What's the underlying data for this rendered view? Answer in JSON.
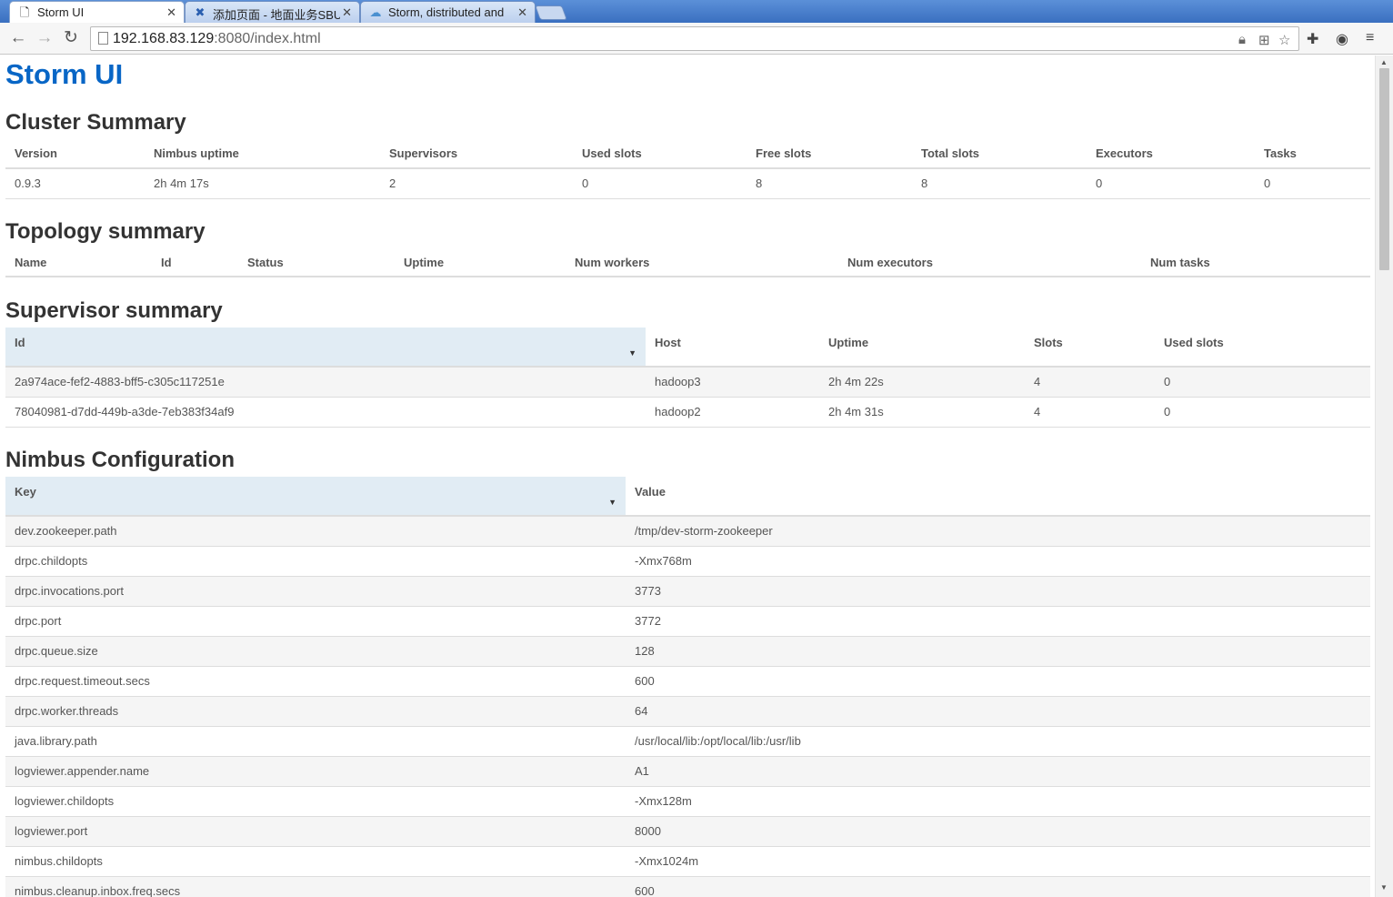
{
  "browser": {
    "tabs": [
      {
        "label": "Storm UI",
        "icon": "page-icon",
        "active": true
      },
      {
        "label": "添加页面 - 地面业务SBU",
        "icon": "confluence-icon",
        "active": false
      },
      {
        "label": "Storm, distributed and",
        "icon": "storm-icon",
        "active": false
      }
    ],
    "url_host": "192.168.83.129",
    "url_rest": ":8080/index.html"
  },
  "page": {
    "logo": "Storm UI"
  },
  "cluster_summary": {
    "title": "Cluster Summary",
    "headers": [
      "Version",
      "Nimbus uptime",
      "Supervisors",
      "Used slots",
      "Free slots",
      "Total slots",
      "Executors",
      "Tasks"
    ],
    "row": [
      "0.9.3",
      "2h 4m 17s",
      "2",
      "0",
      "8",
      "8",
      "0",
      "0"
    ]
  },
  "topology_summary": {
    "title": "Topology summary",
    "headers": [
      "Name",
      "Id",
      "Status",
      "Uptime",
      "Num workers",
      "Num executors",
      "Num tasks"
    ]
  },
  "supervisor_summary": {
    "title": "Supervisor summary",
    "headers": [
      "Id",
      "Host",
      "Uptime",
      "Slots",
      "Used slots"
    ],
    "rows": [
      [
        "2a974ace-fef2-4883-bff5-c305c117251e",
        "hadoop3",
        "2h 4m 22s",
        "4",
        "0"
      ],
      [
        "78040981-d7dd-449b-a3de-7eb383f34af9",
        "hadoop2",
        "2h 4m 31s",
        "4",
        "0"
      ]
    ]
  },
  "nimbus_configuration": {
    "title": "Nimbus Configuration",
    "headers": [
      "Key",
      "Value"
    ],
    "rows": [
      [
        "dev.zookeeper.path",
        "/tmp/dev-storm-zookeeper"
      ],
      [
        "drpc.childopts",
        "-Xmx768m"
      ],
      [
        "drpc.invocations.port",
        "3773"
      ],
      [
        "drpc.port",
        "3772"
      ],
      [
        "drpc.queue.size",
        "128"
      ],
      [
        "drpc.request.timeout.secs",
        "600"
      ],
      [
        "drpc.worker.threads",
        "64"
      ],
      [
        "java.library.path",
        "/usr/local/lib:/opt/local/lib:/usr/lib"
      ],
      [
        "logviewer.appender.name",
        "A1"
      ],
      [
        "logviewer.childopts",
        "-Xmx128m"
      ],
      [
        "logviewer.port",
        "8000"
      ],
      [
        "nimbus.childopts",
        "-Xmx1024m"
      ],
      [
        "nimbus.cleanup.inbox.freq.secs",
        "600"
      ]
    ]
  }
}
